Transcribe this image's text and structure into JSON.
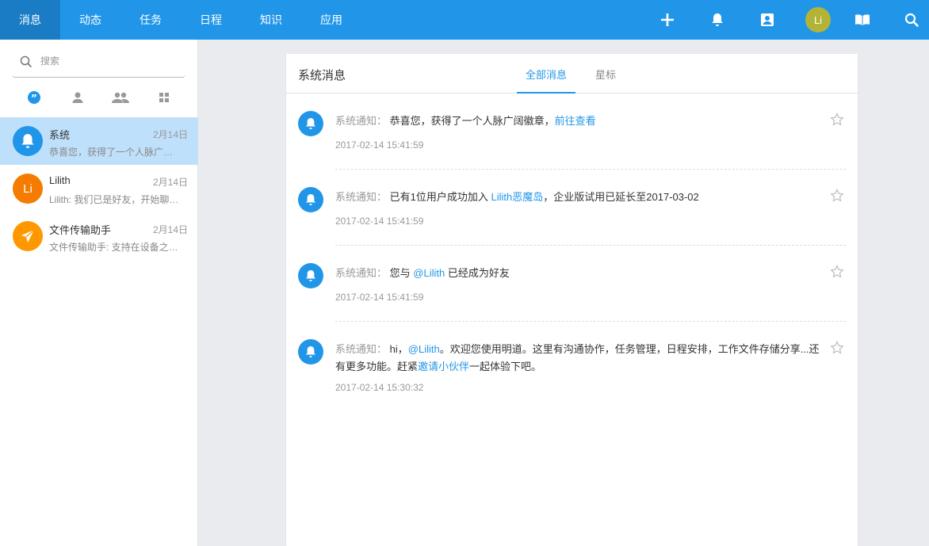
{
  "nav": {
    "tabs": [
      "消息",
      "动态",
      "任务",
      "日程",
      "知识",
      "应用"
    ],
    "avatar_initials": "Li"
  },
  "sidebar": {
    "search_placeholder": "搜索",
    "conversations": [
      {
        "name": "系统",
        "date": "2月14日",
        "preview": "恭喜您，获得了一个人脉广阔徽章",
        "avatar_color": "#2196e8",
        "icon": "bell-icon"
      },
      {
        "name": "Lilith",
        "date": "2月14日",
        "preview": "Lilith: 我们已是好友，开始聊天吧",
        "avatar_color": "#f57c00",
        "avatar_initials": "Li"
      },
      {
        "name": "文件传输助手",
        "date": "2月14日",
        "preview": "文件传输助手: 支持在设备之间传输文件",
        "avatar_color": "#ff9800",
        "icon": "send-icon"
      }
    ]
  },
  "panel": {
    "title": "系统消息",
    "tabs": [
      "全部消息",
      "星标"
    ],
    "messages": [
      {
        "label": "系统通知：",
        "pre": "恭喜您，获得了一个人脉广阔徽章，",
        "link": "前往查看",
        "post": "",
        "time": "2017-02-14 15:41:59"
      },
      {
        "label": "系统通知：",
        "pre": "已有1位用户成功加入",
        "link": "Lilith恶魔岛",
        "post": "，企业版试用已延长至2017-03-02",
        "time": "2017-02-14 15:41:59"
      },
      {
        "label": "系统通知：",
        "pre": "您与",
        "link": "@Lilith",
        "post": "已经成为好友",
        "time": "2017-02-14 15:41:59"
      },
      {
        "label": "系统通知：",
        "pre": "hi，",
        "link": "@Lilith",
        "post": "。欢迎您使用明道。这里有沟通协作，任务管理，日程安排，工作文件存储分享...还有更多功能。赶紧",
        "link2": "邀请小伙伴",
        "post2": "一起体验下吧。",
        "time": "2017-02-14 15:30:32"
      }
    ]
  },
  "colors": {
    "accent": "#2196e8",
    "nav_active": "#1a7cc4",
    "selected_row": "#bfe0fb"
  }
}
